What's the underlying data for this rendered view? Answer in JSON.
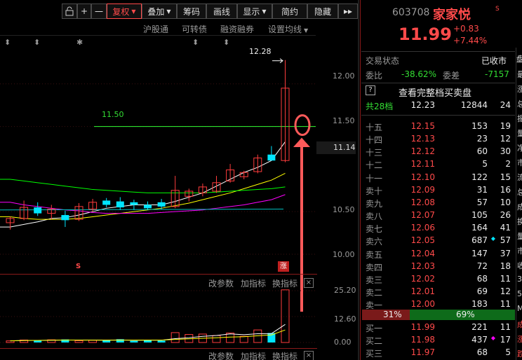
{
  "toolbar": {
    "lock_icon": "lock-icon",
    "plus": "+",
    "minus": "一",
    "fuquan": "复权",
    "diejia": "叠加",
    "chouma": "筹码",
    "huaxian": "画线",
    "xianshi": "显示",
    "jianyue": "简约",
    "yincang": "隐藏",
    "expand": "▸▸"
  },
  "subbar": {
    "hugutong": "沪股通",
    "kezhuanzhai": "可转债",
    "rongzi": "融资融券",
    "shezhi": "设置均线"
  },
  "main_chart": {
    "high_label": "12.28",
    "guide_label": "11.50",
    "y_labels": [
      "12.00",
      "11.50",
      "11.14",
      "10.50",
      "10.00"
    ],
    "limit_up_badge": "涨",
    "s_marker": "S",
    "event_markers": [
      "⬍",
      "⬍",
      "✱",
      "⬍",
      "⬍"
    ],
    "colors": {
      "up": "#ff3c3c",
      "down": "#00e5ff",
      "ma5": "#ffffff",
      "ma10": "#ffff00",
      "ma20": "#ff00ff",
      "ma60": "#00ff00",
      "ma30": "#00bfbf",
      "guide": "#33ff33",
      "annotation": "#ff5a5a"
    }
  },
  "indicator_bar": {
    "params": "改参数",
    "add": "加指标",
    "switch": "换指标",
    "close": "×"
  },
  "volume": {
    "y_labels": [
      "25.20",
      "12.60",
      "0.00"
    ]
  },
  "bottom_bar": {
    "params": "改参数",
    "add": "加指标",
    "switch": "换指标",
    "close": "×"
  },
  "quote": {
    "code": "603708",
    "name": "家家悦",
    "badge": "S",
    "price": "11.99",
    "change": "+0.83",
    "change_pct": "+7.44%",
    "status_label": "交易状态",
    "status_value": "已收市",
    "weibi_label": "委比",
    "weibi_value": "-38.62%",
    "weicha_label": "委差",
    "weicha_value": "-7157",
    "help_icon": "?",
    "full_depth_link": "查看完整档买卖盘",
    "summary": {
      "label": "共28档",
      "price": "12.23",
      "vol": "12844",
      "count": "24"
    },
    "asks": [
      {
        "label": "十五",
        "price": "12.15",
        "vol": "153",
        "count": "19",
        "dot": ""
      },
      {
        "label": "十四",
        "price": "12.13",
        "vol": "23",
        "count": "12",
        "dot": ""
      },
      {
        "label": "十三",
        "price": "12.12",
        "vol": "60",
        "count": "30",
        "dot": ""
      },
      {
        "label": "十二",
        "price": "12.11",
        "vol": "5",
        "count": "2",
        "dot": ""
      },
      {
        "label": "十一",
        "price": "12.10",
        "vol": "122",
        "count": "15",
        "dot": ""
      },
      {
        "label": "卖十",
        "price": "12.09",
        "vol": "31",
        "count": "16",
        "dot": ""
      },
      {
        "label": "卖九",
        "price": "12.08",
        "vol": "57",
        "count": "10",
        "dot": ""
      },
      {
        "label": "卖八",
        "price": "12.07",
        "vol": "105",
        "count": "26",
        "dot": ""
      },
      {
        "label": "卖七",
        "price": "12.06",
        "vol": "164",
        "count": "41",
        "dot": ""
      },
      {
        "label": "卖六",
        "price": "12.05",
        "vol": "687",
        "count": "57",
        "dot": "◆"
      },
      {
        "label": "卖五",
        "price": "12.04",
        "vol": "147",
        "count": "37",
        "dot": ""
      },
      {
        "label": "卖四",
        "price": "12.03",
        "vol": "72",
        "count": "18",
        "dot": ""
      },
      {
        "label": "卖三",
        "price": "12.02",
        "vol": "68",
        "count": "11",
        "dot": ""
      },
      {
        "label": "卖二",
        "price": "12.01",
        "vol": "69",
        "count": "12",
        "dot": ""
      },
      {
        "label": "卖一",
        "price": "12.00",
        "vol": "183",
        "count": "11",
        "dot": ""
      }
    ],
    "ratio": {
      "left": "31%",
      "right": "69%",
      "left_fraction": 0.31
    },
    "bids": [
      {
        "label": "买一",
        "price": "11.99",
        "vol": "221",
        "count": "11",
        "dot": ""
      },
      {
        "label": "买二",
        "price": "11.98",
        "vol": "437",
        "count": "17",
        "dot": "◆"
      },
      {
        "label": "买三",
        "price": "11.97",
        "vol": "68",
        "count": "5",
        "dot": ""
      }
    ],
    "side_tab": "盘",
    "side_clip": [
      "最",
      "涨",
      "总",
      "振",
      "量",
      "净",
      "市",
      "流",
      "总",
      "成",
      "换",
      "量",
      "市",
      "收",
      "3",
      "5",
      "M",
      "成",
      "涨",
      "跌"
    ]
  },
  "chart_data": {
    "type": "candlestick",
    "title": "",
    "y_ticks": [
      12.0,
      11.5,
      11.14,
      10.5,
      10.0
    ],
    "ylim": [
      9.86,
      12.36
    ],
    "current_price_label": 11.14,
    "high_annotation": 12.28,
    "guide_line": 11.5,
    "candles": [
      {
        "o": 10.37,
        "h": 10.44,
        "l": 10.29,
        "c": 10.42
      },
      {
        "o": 10.42,
        "h": 10.63,
        "l": 10.4,
        "c": 10.55
      },
      {
        "o": 10.55,
        "h": 10.61,
        "l": 10.45,
        "c": 10.48
      },
      {
        "o": 10.48,
        "h": 10.58,
        "l": 10.41,
        "c": 10.53
      },
      {
        "o": 10.46,
        "h": 10.51,
        "l": 10.32,
        "c": 10.4
      },
      {
        "o": 10.41,
        "h": 10.6,
        "l": 10.39,
        "c": 10.56
      },
      {
        "o": 10.53,
        "h": 10.65,
        "l": 10.5,
        "c": 10.61
      },
      {
        "o": 10.63,
        "h": 10.66,
        "l": 10.55,
        "c": 10.58
      },
      {
        "o": 10.62,
        "h": 10.67,
        "l": 10.52,
        "c": 10.55
      },
      {
        "o": 10.61,
        "h": 10.64,
        "l": 10.52,
        "c": 10.58
      },
      {
        "o": 10.58,
        "h": 10.62,
        "l": 10.52,
        "c": 10.54
      },
      {
        "o": 10.61,
        "h": 10.65,
        "l": 10.53,
        "c": 10.56
      },
      {
        "o": 10.56,
        "h": 10.92,
        "l": 10.54,
        "c": 10.75
      },
      {
        "o": 10.68,
        "h": 10.77,
        "l": 10.62,
        "c": 10.74
      },
      {
        "o": 10.72,
        "h": 10.83,
        "l": 10.68,
        "c": 10.79
      },
      {
        "o": 10.74,
        "h": 10.92,
        "l": 10.72,
        "c": 10.84
      },
      {
        "o": 10.86,
        "h": 11.06,
        "l": 10.84,
        "c": 10.99
      },
      {
        "o": 10.91,
        "h": 10.98,
        "l": 10.88,
        "c": 10.96
      },
      {
        "o": 10.97,
        "h": 11.17,
        "l": 10.95,
        "c": 11.13
      },
      {
        "o": 11.17,
        "h": 11.27,
        "l": 11.15,
        "c": 11.1
      },
      {
        "o": 11.1,
        "h": 12.28,
        "l": 11.08,
        "c": 11.95
      }
    ],
    "volume_ticks": [
      25.2,
      12.6,
      0.0
    ],
    "volume": [
      0.8,
      1.2,
      1.1,
      1.3,
      1.5,
      0.9,
      1.1,
      1.0,
      1.6,
      0.8,
      1.2,
      0.9,
      4.8,
      3.9,
      4.1,
      3.4,
      4.6,
      3.0,
      6.1,
      4.6,
      25.6
    ],
    "ma_lines": [
      {
        "color": "#ffffff",
        "values": [
          10.32,
          10.35,
          10.38,
          10.42,
          10.43,
          10.46,
          10.5,
          10.54,
          10.56,
          10.58,
          10.58,
          10.58,
          10.62,
          10.67,
          10.72,
          10.8,
          10.88,
          10.96,
          11.02,
          11.1,
          11.32
        ]
      },
      {
        "color": "#ffff00",
        "values": [
          10.44,
          10.42,
          10.41,
          10.41,
          10.41,
          10.42,
          10.44,
          10.46,
          10.48,
          10.5,
          10.52,
          10.54,
          10.57,
          10.6,
          10.64,
          10.68,
          10.72,
          10.77,
          10.82,
          10.87,
          10.95
        ]
      },
      {
        "color": "#ff00ff",
        "values": [
          10.61,
          10.58,
          10.56,
          10.54,
          10.52,
          10.51,
          10.49,
          10.48,
          10.48,
          10.48,
          10.48,
          10.49,
          10.5,
          10.51,
          10.52,
          10.54,
          10.56,
          10.58,
          10.61,
          10.64,
          10.7
        ]
      },
      {
        "color": "#00ff00",
        "values": [
          10.88,
          10.86,
          10.84,
          10.82,
          10.8,
          10.78,
          10.76,
          10.75,
          10.74,
          10.73,
          10.72,
          10.72,
          10.72,
          10.72,
          10.72,
          10.73,
          10.74,
          10.75,
          10.76,
          10.77,
          10.79
        ]
      }
    ]
  }
}
